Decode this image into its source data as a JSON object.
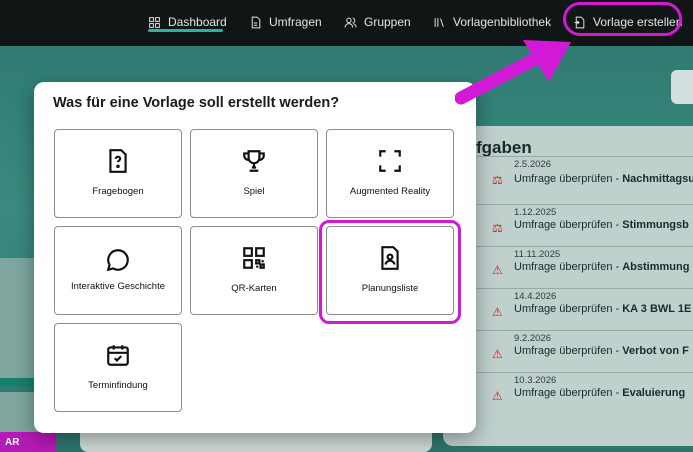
{
  "nav": {
    "items": [
      {
        "label": "Dashboard",
        "icon": "dashboard-icon"
      },
      {
        "label": "Umfragen",
        "icon": "document-icon"
      },
      {
        "label": "Gruppen",
        "icon": "users-icon"
      },
      {
        "label": "Vorlagenbibliothek",
        "icon": "library-icon"
      },
      {
        "label": "Vorlage erstellen",
        "icon": "create-template-icon"
      }
    ]
  },
  "background": {
    "section_title": "fgaben",
    "tasks": [
      {
        "date": "2.5.2026",
        "text": "Umfrage überprüfen",
        "detail": "Nachmittagsu",
        "alert": "scale"
      },
      {
        "date": "1.12.2025",
        "text": "Umfrage überprüfen",
        "detail": "Stimmungsb",
        "alert": "scale"
      },
      {
        "date": "11.11.2025",
        "text": "Umfrage überprüfen",
        "detail": "Abstimmung",
        "alert": "warning"
      },
      {
        "date": "14.4.2026",
        "text": "Umfrage überprüfen",
        "detail": "KA 3 BWL 1E",
        "alert": "warning"
      },
      {
        "date": "9.2.2026",
        "text": "Umfrage überprüfen",
        "detail": "Verbot von F",
        "alert": "warning"
      },
      {
        "date": "10.3.2026",
        "text": "Umfrage überprüfen",
        "detail": "Evaluierung",
        "alert": "warning"
      }
    ],
    "badge": "AR"
  },
  "modal": {
    "title": "Was für eine Vorlage soll erstellt werden?",
    "close_symbol": "×",
    "options": [
      {
        "label": "Fragebogen",
        "icon": "question-document-icon"
      },
      {
        "label": "Spiel",
        "icon": "trophy-icon"
      },
      {
        "label": "Augmented Reality",
        "icon": "scan-frame-icon"
      },
      {
        "label": "Interaktive Geschichte",
        "icon": "speech-bubble-icon"
      },
      {
        "label": "QR-Karten",
        "icon": "qr-code-icon"
      },
      {
        "label": "Planungsliste",
        "icon": "person-document-icon"
      },
      {
        "label": "Terminfindung",
        "icon": "calendar-check-icon"
      }
    ]
  },
  "colors": {
    "accent_highlight": "#d21ad6",
    "nav_active": "#2bb39b"
  }
}
